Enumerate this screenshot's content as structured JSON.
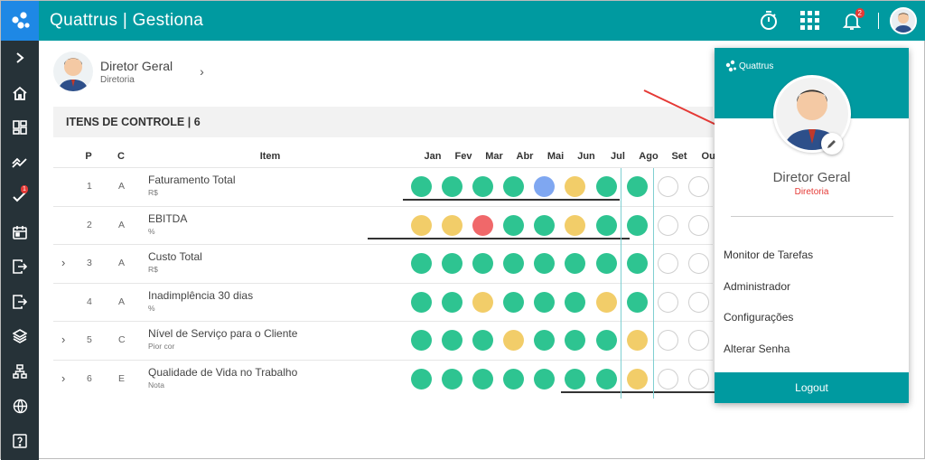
{
  "app": {
    "title": "Quattrus | Gestiona",
    "notification_count": "2"
  },
  "sidebar": {
    "items": [
      {
        "icon": "chevron-right-icon"
      },
      {
        "icon": "home-icon"
      },
      {
        "icon": "dashboard-icon"
      },
      {
        "icon": "trend-icon"
      },
      {
        "icon": "tasks-check-icon",
        "badge": "1"
      },
      {
        "icon": "calendar-icon"
      },
      {
        "icon": "export-icon"
      },
      {
        "icon": "import-icon"
      },
      {
        "icon": "layers-icon"
      },
      {
        "icon": "org-chart-icon"
      },
      {
        "icon": "globe-icon"
      },
      {
        "icon": "help-icon"
      }
    ]
  },
  "user": {
    "name": "Diretor Geral",
    "area": "Diretoria"
  },
  "section": {
    "title": "ITENS DE CONTROLE | 6"
  },
  "table": {
    "headers": {
      "p": "P",
      "c": "C",
      "item": "Item"
    },
    "months": [
      "Jan",
      "Fev",
      "Mar",
      "Abr",
      "Mai",
      "Jun",
      "Jul",
      "Ago",
      "Set",
      "Out"
    ],
    "rows": [
      {
        "p": "1",
        "c": "A",
        "name": "Faturamento Total",
        "unit": "R$",
        "expandable": false,
        "status": [
          "green",
          "green",
          "green",
          "green",
          "blue",
          "yellow",
          "green",
          "green",
          "empty",
          "empty"
        ]
      },
      {
        "p": "2",
        "c": "A",
        "name": "EBITDA",
        "unit": "%",
        "expandable": false,
        "status": [
          "yellow",
          "yellow",
          "red",
          "green",
          "green",
          "yellow",
          "green",
          "green",
          "empty",
          "empty"
        ]
      },
      {
        "p": "3",
        "c": "A",
        "name": "Custo Total",
        "unit": "R$",
        "expandable": true,
        "status": [
          "green",
          "green",
          "green",
          "green",
          "green",
          "green",
          "green",
          "green",
          "empty",
          "empty"
        ]
      },
      {
        "p": "4",
        "c": "A",
        "name": "Inadimplência 30 dias",
        "unit": "%",
        "expandable": false,
        "status": [
          "green",
          "green",
          "yellow",
          "green",
          "green",
          "green",
          "yellow",
          "green",
          "empty",
          "empty"
        ]
      },
      {
        "p": "5",
        "c": "C",
        "name": "Nível de Serviço para o Cliente",
        "unit": "Pior cor",
        "expandable": true,
        "status": [
          "green",
          "green",
          "green",
          "yellow",
          "green",
          "green",
          "green",
          "yellow",
          "empty",
          "empty"
        ]
      },
      {
        "p": "6",
        "c": "E",
        "name": "Qualidade de Vida no Trabalho",
        "unit": "Nota",
        "expandable": true,
        "status": [
          "green",
          "green",
          "green",
          "green",
          "green",
          "green",
          "green",
          "yellow",
          "empty",
          "empty"
        ]
      }
    ]
  },
  "dropdown": {
    "brand": "Quattrus",
    "name": "Diretor Geral",
    "role": "Diretoria",
    "menu": [
      "Monitor de Tarefas",
      "Administrador",
      "Configurações",
      "Alterar Senha"
    ],
    "logout": "Logout"
  },
  "colors": {
    "teal": "#009aa0",
    "green": "#2ec491",
    "yellow": "#f2cd69",
    "red": "#f0686a",
    "blue": "#7fa7f1",
    "sidebar": "#263238"
  }
}
